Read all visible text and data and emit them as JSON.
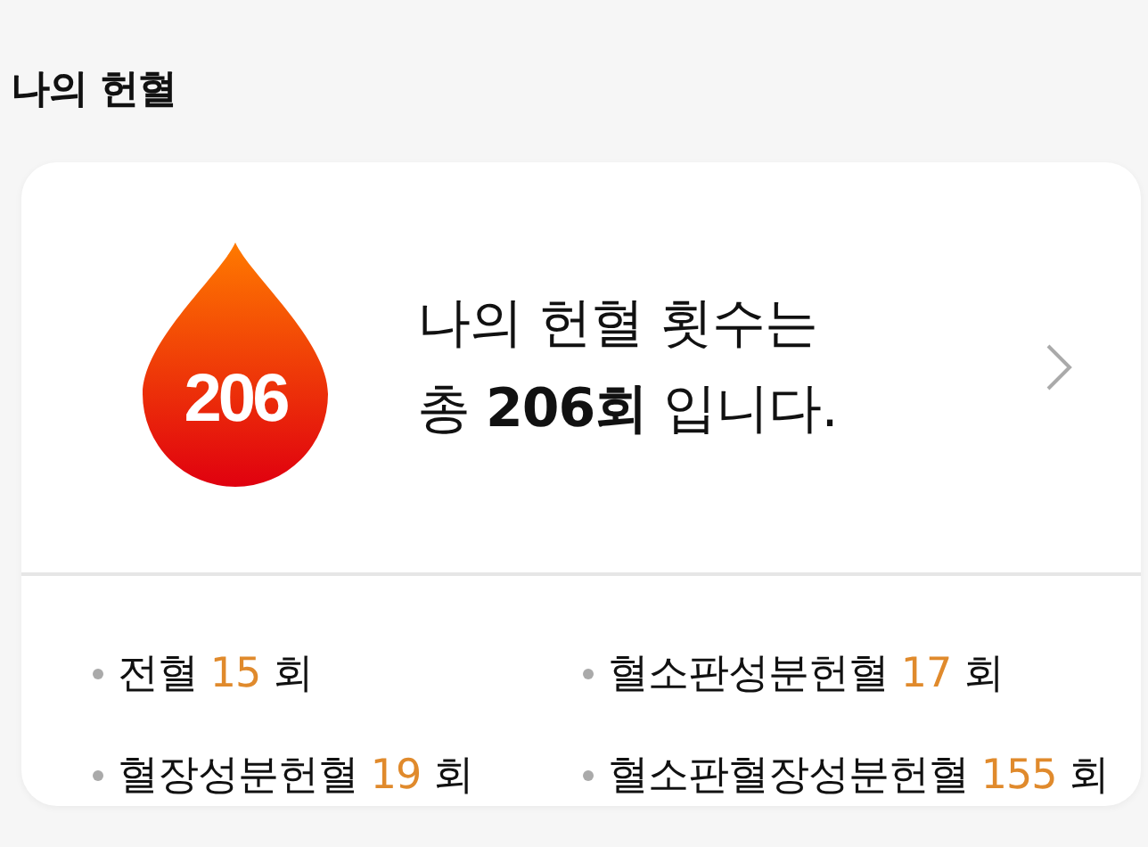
{
  "title": "나의 헌혈",
  "summary": {
    "badge": "206",
    "lines": [
      "나의 헌혈 횟수는",
      "총 **206회** 입니다."
    ]
  },
  "counts": [
    {
      "label": "전혈",
      "count": "15",
      "unit": "회"
    },
    {
      "label": "혈소판성분헌혈",
      "count": "17",
      "unit": "회"
    },
    {
      "label": "혈장성분헌혈",
      "count": "19",
      "unit": "회"
    },
    {
      "label": "혈소판혈장성분헌혈",
      "count": "155",
      "unit": "회"
    }
  ]
}
